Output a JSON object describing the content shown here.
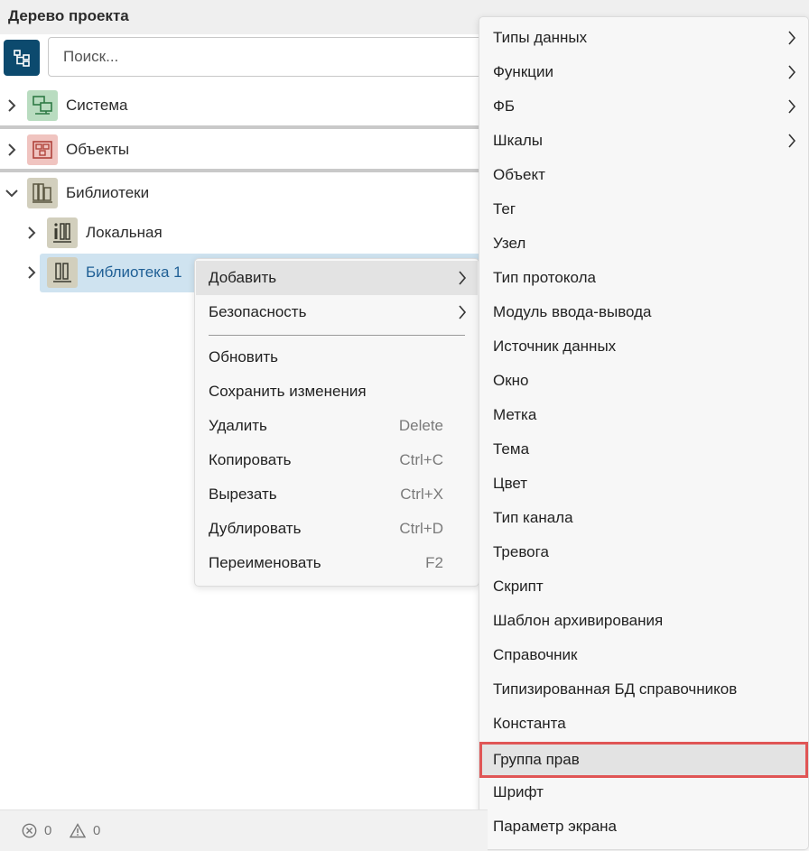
{
  "panel": {
    "title": "Дерево проекта"
  },
  "search": {
    "placeholder": "Поиск..."
  },
  "tree": {
    "system": "Система",
    "objects": "Объекты",
    "libraries": "Библиотеки",
    "local": "Локальная",
    "library1": "Библиотека 1"
  },
  "context_menu": {
    "add": "Добавить",
    "security": "Безопасность",
    "refresh": "Обновить",
    "save": "Сохранить изменения",
    "delete": "Удалить",
    "delete_sc": "Delete",
    "copy": "Копировать",
    "copy_sc": "Ctrl+C",
    "cut": "Вырезать",
    "cut_sc": "Ctrl+X",
    "duplicate": "Дублировать",
    "duplicate_sc": "Ctrl+D",
    "rename": "Переименовать",
    "rename_sc": "F2"
  },
  "submenu": [
    "Типы данных",
    "Функции",
    "ФБ",
    "Шкалы",
    "Объект",
    "Тег",
    "Узел",
    "Тип протокола",
    "Модуль ввода-вывода",
    "Источник данных",
    "Окно",
    "Метка",
    "Тема",
    "Цвет",
    "Тип канала",
    "Тревога",
    "Скрипт",
    "Шаблон архивирования",
    "Справочник",
    "Типизированная БД справочников",
    "Константа",
    "Группа прав",
    "Шрифт",
    "Параметр экрана"
  ],
  "status": {
    "errors": "0",
    "warnings": "0"
  },
  "colors": {
    "tree_button": "#0c4a6e",
    "system_icon_bg": "#b9dcc0",
    "objects_icon_bg": "#f0c4c0",
    "library_icon_bg": "#d2cfbd",
    "selection": "#cfe3f0",
    "highlight_border": "#e05555"
  }
}
